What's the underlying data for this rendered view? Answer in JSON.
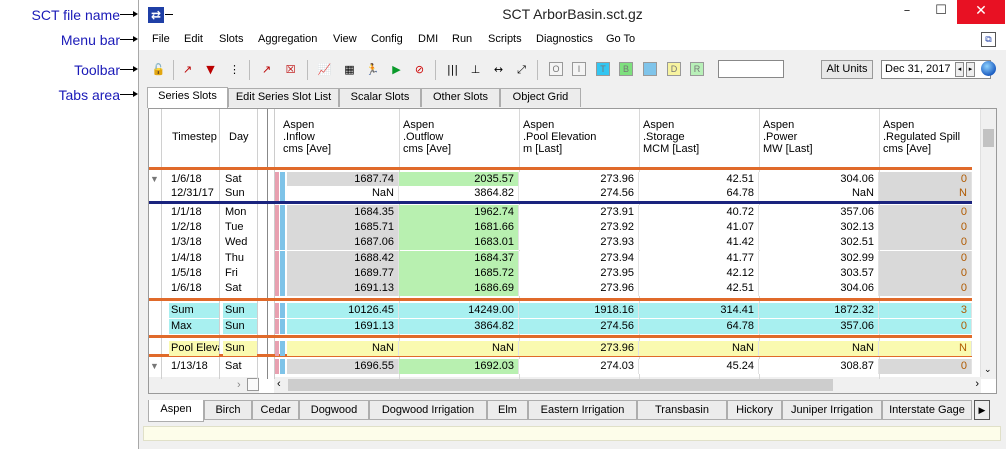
{
  "annotations": {
    "sct_file_name": "SCT file name",
    "menu_bar": "Menu bar",
    "toolbar": "Toolbar",
    "tabs_area": "Tabs area"
  },
  "window": {
    "title": "SCT ArborBasin.sct.gz",
    "minimize_icon": "minimize-icon",
    "maximize_icon": "maximize-icon",
    "close_icon": "close-icon"
  },
  "menu": [
    "File",
    "Edit",
    "Slots",
    "Aggregation",
    "View",
    "Config",
    "DMI",
    "Run",
    "Scripts",
    "Diagnostics",
    "Go To"
  ],
  "toolbar": {
    "alt_units": "Alt Units",
    "date": "Dec 31, 2017",
    "spin_left": "◂",
    "spin_right": "▸",
    "flag_letters": [
      "O",
      "I",
      "T",
      "B",
      "",
      "D",
      "R"
    ],
    "flag_colors": [
      "#f4f4f4",
      "#f4f4f4",
      "#33c6f2",
      "#7ee07e",
      "#7fc4ea",
      "#f7f3a0",
      "#b8f0b8"
    ]
  },
  "tabs": [
    "Series Slots",
    "Edit Series Slot List",
    "Scalar Slots",
    "Other Slots",
    "Object Grid"
  ],
  "grid": {
    "header": {
      "timestep": "Timestep",
      "day": "Day"
    },
    "columns": [
      {
        "object": "Aspen",
        "slot": ".Inflow",
        "unit": "cms [Ave]"
      },
      {
        "object": "Aspen",
        "slot": ".Outflow",
        "unit": "cms [Ave]"
      },
      {
        "object": "Aspen",
        "slot": ".Pool Elevation",
        "unit": "m [Last]"
      },
      {
        "object": "Aspen",
        "slot": ".Storage",
        "unit": "MCM [Last]"
      },
      {
        "object": "Aspen",
        "slot": ".Power",
        "unit": "MW [Last]"
      },
      {
        "object": "Aspen",
        "slot": ".Regulated Spill",
        "unit": "cms [Ave]"
      }
    ],
    "rows": [
      {
        "ts": "1/6/18",
        "day": "Sat",
        "vals": [
          "1687.74",
          "2035.57",
          "273.96",
          "42.51",
          "304.06",
          "0"
        ],
        "arrow": "▼"
      },
      {
        "ts": "12/31/17",
        "day": "Sun",
        "vals": [
          "NaN",
          "3864.82",
          "274.56",
          "64.78",
          "NaN",
          "N"
        ],
        "arrow": ""
      },
      {
        "ts": "1/1/18",
        "day": "Mon",
        "vals": [
          "1684.35",
          "1962.74",
          "273.91",
          "40.72",
          "357.06",
          "0"
        ],
        "arrow": ""
      },
      {
        "ts": "1/2/18",
        "day": "Tue",
        "vals": [
          "1685.71",
          "1681.66",
          "273.92",
          "41.07",
          "302.13",
          "0"
        ],
        "arrow": ""
      },
      {
        "ts": "1/3/18",
        "day": "Wed",
        "vals": [
          "1687.06",
          "1683.01",
          "273.93",
          "41.42",
          "302.51",
          "0"
        ],
        "arrow": ""
      },
      {
        "ts": "1/4/18",
        "day": "Thu",
        "vals": [
          "1688.42",
          "1684.37",
          "273.94",
          "41.77",
          "302.99",
          "0"
        ],
        "arrow": ""
      },
      {
        "ts": "1/5/18",
        "day": "Fri",
        "vals": [
          "1689.77",
          "1685.72",
          "273.95",
          "42.12",
          "303.57",
          "0"
        ],
        "arrow": ""
      },
      {
        "ts": "1/6/18",
        "day": "Sat",
        "vals": [
          "1691.13",
          "1686.69",
          "273.96",
          "42.51",
          "304.06",
          "0"
        ],
        "arrow": ""
      },
      {
        "ts": "Sum",
        "day": "Sun",
        "vals": [
          "10126.45",
          "14249.00",
          "1918.16",
          "314.41",
          "1872.32",
          "3"
        ],
        "arrow": ""
      },
      {
        "ts": "Max",
        "day": "Sun",
        "vals": [
          "1691.13",
          "3864.82",
          "274.56",
          "64.78",
          "357.06",
          "0"
        ],
        "arrow": ""
      },
      {
        "ts": "Pool Elevat",
        "day": "Sun",
        "vals": [
          "NaN",
          "NaN",
          "273.96",
          "NaN",
          "NaN",
          "N"
        ],
        "arrow": ""
      },
      {
        "ts": "1/13/18",
        "day": "Sat",
        "vals": [
          "1696.55",
          "1692.03",
          "274.03",
          "45.24",
          "308.87",
          "0"
        ],
        "arrow": "▼"
      }
    ]
  },
  "bottom_tabs": [
    "Aspen",
    "Birch",
    "Cedar",
    "Dogwood",
    "Dogwood Irrigation",
    "Elm",
    "Eastern Irrigation",
    "Transbasin",
    "Hickory",
    "Juniper Irrigation",
    "Interstate Gage"
  ]
}
